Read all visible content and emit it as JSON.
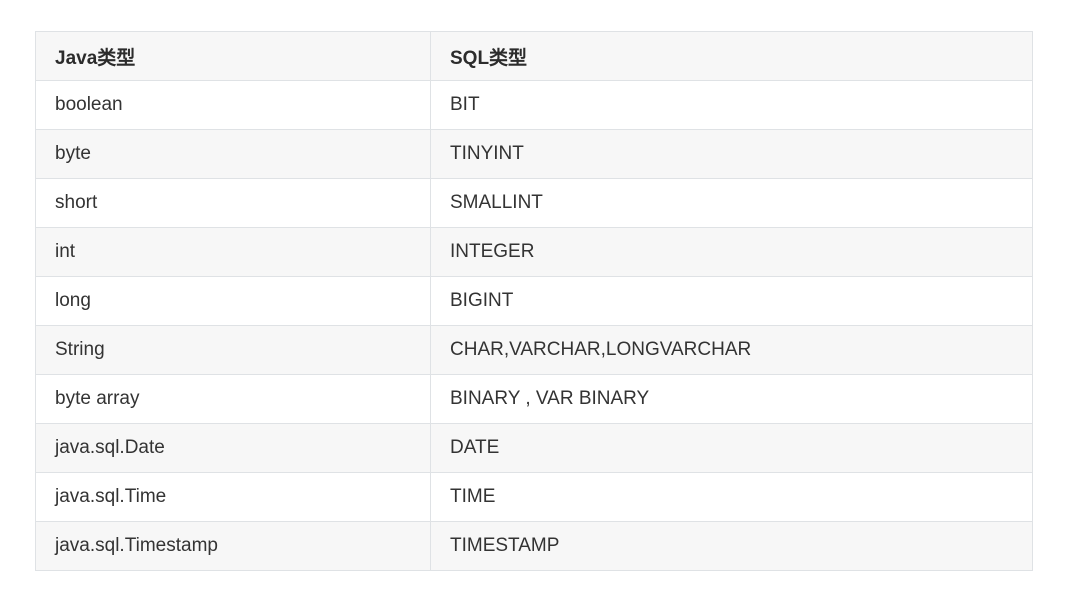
{
  "table": {
    "headers": [
      "Java类型",
      "SQL类型"
    ],
    "rows": [
      [
        "boolean",
        "BIT"
      ],
      [
        "byte",
        "TINYINT"
      ],
      [
        "short",
        "SMALLINT"
      ],
      [
        "int",
        "INTEGER"
      ],
      [
        "long",
        "BIGINT"
      ],
      [
        "String",
        "CHAR,VARCHAR,LONGVARCHAR"
      ],
      [
        "byte array",
        "BINARY , VAR BINARY"
      ],
      [
        "java.sql.Date",
        "DATE"
      ],
      [
        "java.sql.Time",
        "TIME"
      ],
      [
        "java.sql.Timestamp",
        "TIMESTAMP"
      ]
    ]
  },
  "colors": {
    "header_bg": "#f7f7f7",
    "stripe_bg": "#f7f7f7",
    "border": "#dfe2e5",
    "text": "#333333"
  }
}
